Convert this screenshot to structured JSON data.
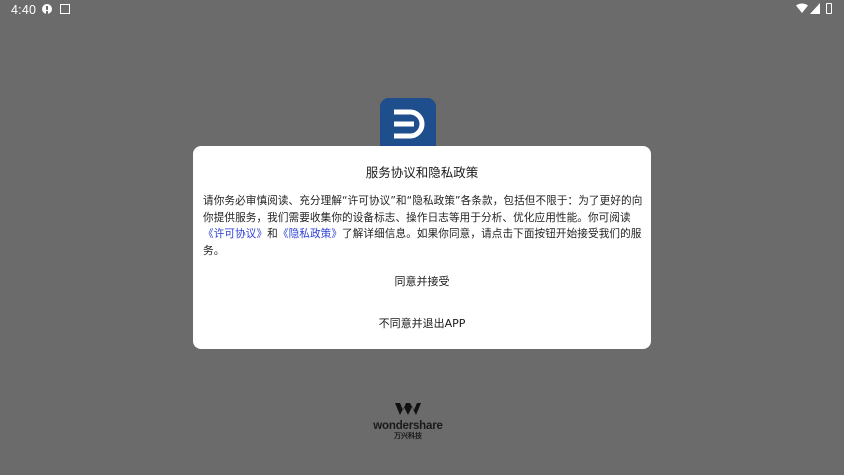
{
  "status_bar": {
    "time": "4:40",
    "icons": [
      "alert-icon",
      "a-icon",
      "wifi-icon",
      "signal-icon",
      "battery-icon"
    ]
  },
  "app": {
    "logo_icon": "app-logo-d-icon",
    "brand_name": "wondershare",
    "brand_sub": "万兴科技"
  },
  "dialog": {
    "title": "服务协议和隐私政策",
    "body_part1": "请你务必审慎阅读、充分理解“许可协议”和“隐私政策”各条款，包括但不限于：为了更好的向你提供服务，我们需要收集你的设备标志、操作日志等用于分析、优化应用性能。你可阅读",
    "link_license": "《许可协议》",
    "body_and": "和",
    "link_privacy": "《隐私政策》",
    "body_part2": "了解详细信息。如果你同意，请点击下面按钮开始接受我们的服务。",
    "agree_label": "同意并接受",
    "disagree_label": "不同意并退出APP"
  },
  "colors": {
    "scrim": "#6b6b6b",
    "link": "#2a3fd6",
    "logo_bg": "#1f4e8c"
  }
}
